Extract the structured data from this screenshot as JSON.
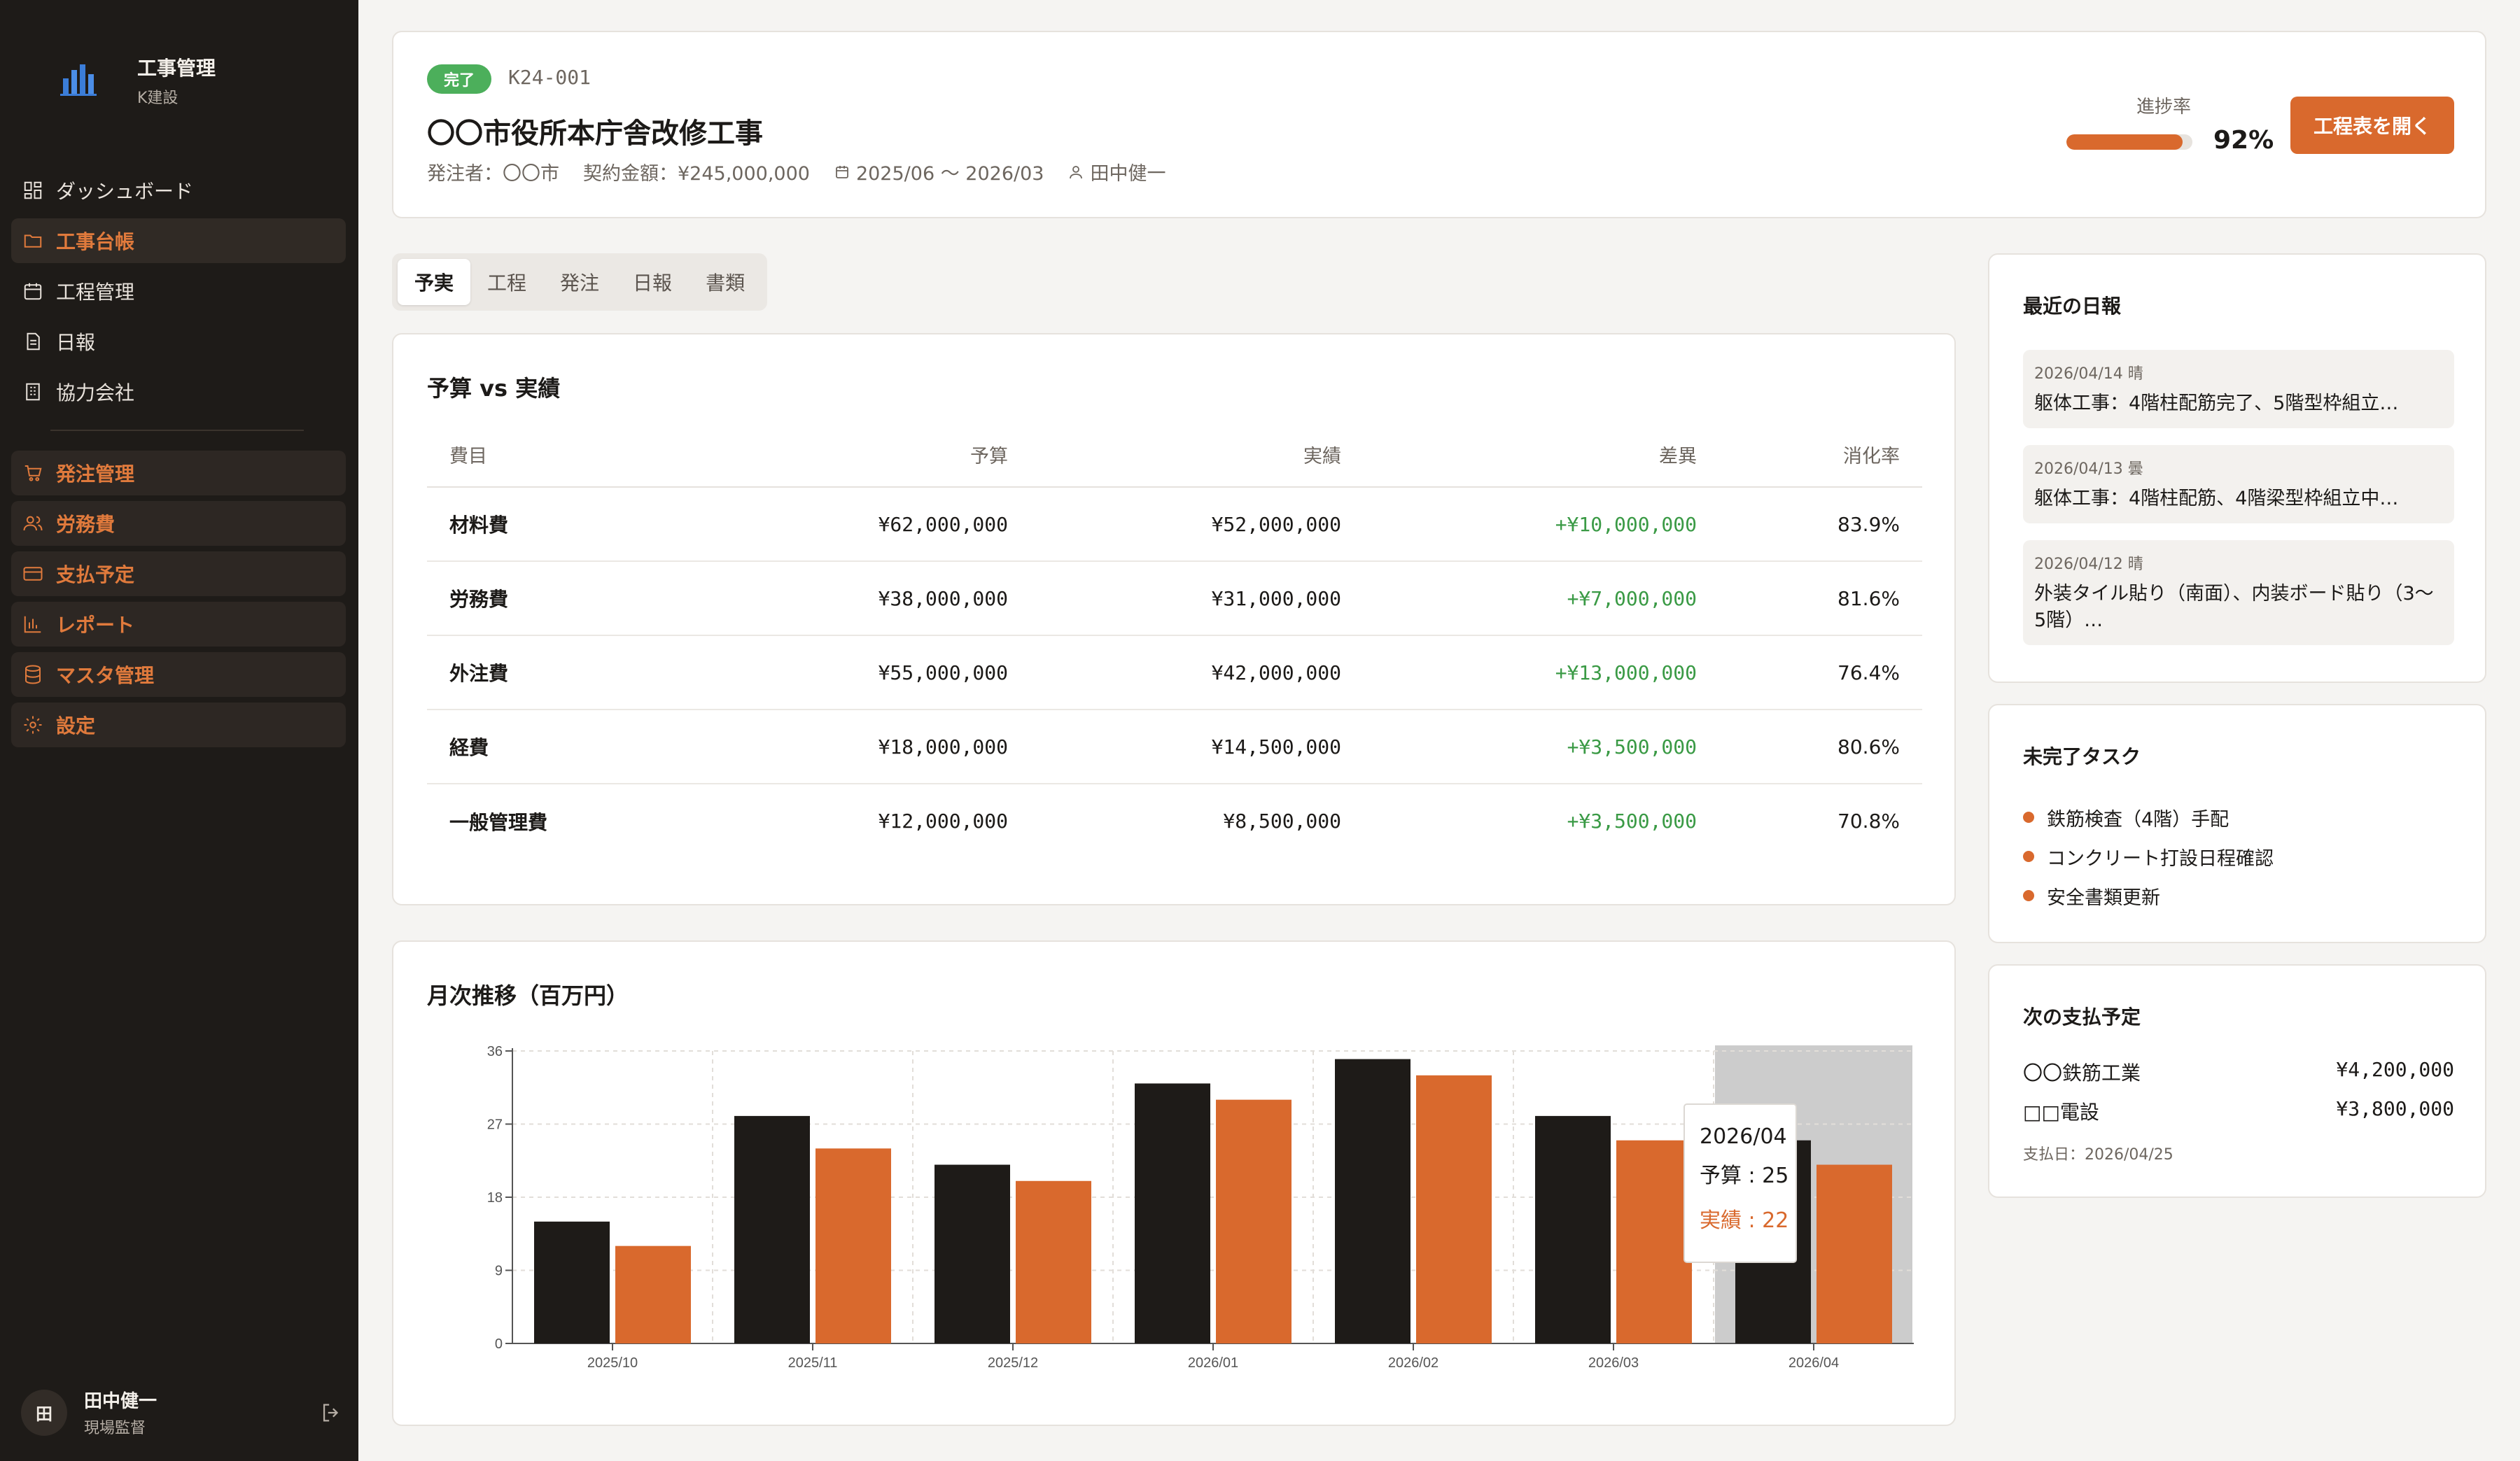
{
  "app": {
    "title": "工事管理",
    "subtitle": "K建設"
  },
  "sidebar": {
    "items": [
      {
        "label": "ダッシュボード",
        "icon": "dashboard-icon"
      },
      {
        "label": "工事台帳",
        "icon": "folder-icon"
      },
      {
        "label": "工程管理",
        "icon": "calendar-icon"
      },
      {
        "label": "日報",
        "icon": "document-icon"
      },
      {
        "label": "協力会社",
        "icon": "building-icon"
      }
    ],
    "secondary_items": [
      {
        "label": "発注管理",
        "icon": "cart-icon"
      },
      {
        "label": "労務費",
        "icon": "users-icon"
      },
      {
        "label": "支払予定",
        "icon": "card-icon"
      },
      {
        "label": "レポート",
        "icon": "bar-chart-icon"
      },
      {
        "label": "マスタ管理",
        "icon": "database-icon"
      },
      {
        "label": "設定",
        "icon": "gear-icon"
      }
    ]
  },
  "user": {
    "initial": "田",
    "name": "田中健一",
    "role": "現場監督"
  },
  "project": {
    "status": "完了",
    "code": "K24-001",
    "title": "〇〇市役所本庁舎改修工事",
    "client": "発注者：〇〇市",
    "amount": "契約金額：¥245,000,000",
    "period": "2025/06 〜 2026/03",
    "manager": "田中健一",
    "progress_label": "進捗率",
    "progress_value": "92%",
    "progress_fraction": 0.92,
    "schedule_button": "工程表を開く"
  },
  "tabs": [
    "予実",
    "工程",
    "発注",
    "日報",
    "書類"
  ],
  "budget": {
    "title": "予算 vs 実績",
    "headers": [
      "費目",
      "予算",
      "実績",
      "差異",
      "消化率"
    ],
    "rows": [
      [
        "材料費",
        "¥62,000,000",
        "¥52,000,000",
        "+¥10,000,000",
        "83.9%"
      ],
      [
        "労務費",
        "¥38,000,000",
        "¥31,000,000",
        "+¥7,000,000",
        "81.6%"
      ],
      [
        "外注費",
        "¥55,000,000",
        "¥42,000,000",
        "+¥13,000,000",
        "76.4%"
      ],
      [
        "経費",
        "¥18,000,000",
        "¥14,500,000",
        "+¥3,500,000",
        "80.6%"
      ],
      [
        "一般管理費",
        "¥12,000,000",
        "¥8,500,000",
        "+¥3,500,000",
        "70.8%"
      ]
    ]
  },
  "chart_title": "月次推移（百万円）",
  "chart_data": {
    "type": "bar",
    "categories": [
      "2025/10",
      "2025/11",
      "2025/12",
      "2026/01",
      "2026/02",
      "2026/03",
      "2026/04"
    ],
    "series": [
      {
        "name": "予算",
        "values": [
          15,
          28,
          22,
          32,
          35,
          28,
          25
        ],
        "color": "#1e1b18"
      },
      {
        "name": "実績",
        "values": [
          12,
          24,
          20,
          30,
          33,
          25,
          22
        ],
        "color": "#d9692d"
      }
    ],
    "ylim": [
      0,
      36
    ],
    "yticks": [
      0,
      9,
      18,
      27,
      36
    ],
    "grid": true,
    "highlighted_category": "2026/04",
    "tooltip": {
      "title": "2026/04",
      "lines": [
        "予算 : 25",
        "実績 : 22"
      ]
    }
  },
  "reports": {
    "title": "最近の日報",
    "items": [
      {
        "date": "2026/04/14 晴",
        "text": "躯体工事：4階柱配筋完了、5階型枠組立…"
      },
      {
        "date": "2026/04/13 曇",
        "text": "躯体工事：4階柱配筋、4階梁型枠組立中…"
      },
      {
        "date": "2026/04/12 晴",
        "text": "外装タイル貼り（南面）、内装ボード貼り（3〜5階）…"
      }
    ]
  },
  "tasks": {
    "title": "未完了タスク",
    "items": [
      "鉄筋検査（4階）手配",
      "コンクリート打設日程確認",
      "安全書類更新"
    ]
  },
  "payments": {
    "title": "次の支払予定",
    "items": [
      {
        "vendor": "〇〇鉄筋工業",
        "amount": "¥4,200,000"
      },
      {
        "vendor": "□□電設",
        "amount": "¥3,800,000"
      }
    ],
    "date": "支払日：2026/04/25"
  },
  "colors": {
    "accent": "#d9692d",
    "success": "#4caf5b",
    "sidebar": "#1e1b18"
  }
}
